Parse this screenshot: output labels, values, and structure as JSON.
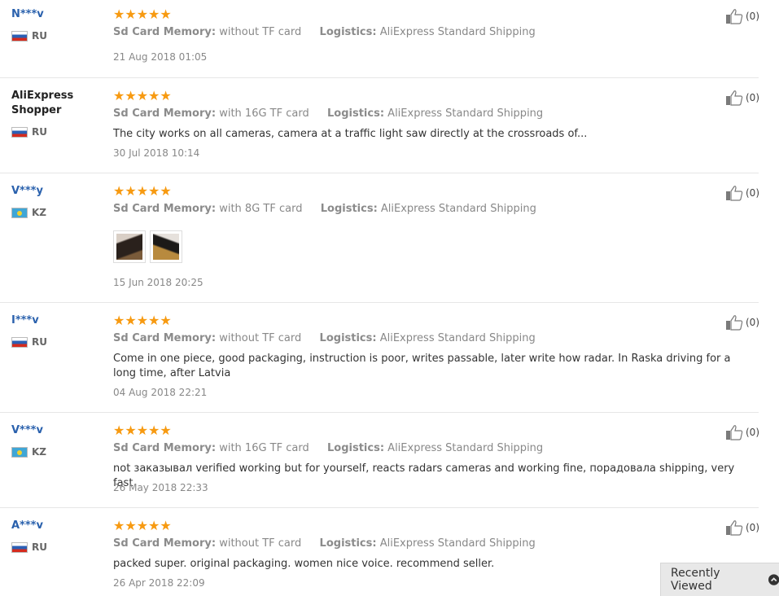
{
  "labels": {
    "sd_card_memory": "Sd Card Memory:",
    "logistics": "Logistics:"
  },
  "reviews": [
    {
      "user": "N***v",
      "country": "RU",
      "rating": "★★★★★",
      "sd_card": "without TF card",
      "logistics": "AliExpress Standard Shipping",
      "comment": "",
      "date": "21 Aug 2018 01:05",
      "helpful": "(0)"
    },
    {
      "user": "AliExpress Shopper",
      "country": "RU",
      "rating": "★★★★★",
      "sd_card": "with 16G TF card",
      "logistics": "AliExpress Standard Shipping",
      "comment": "The city works on all cameras, camera at a traffic light saw directly at the crossroads of...",
      "date": "30 Jul 2018 10:14",
      "helpful": "(0)"
    },
    {
      "user": "V***y",
      "country": "KZ",
      "rating": "★★★★★",
      "sd_card": "with 8G TF card",
      "logistics": "AliExpress Standard Shipping",
      "comment": "",
      "date": "15 Jun 2018 20:25",
      "helpful": "(0)",
      "photos": 2
    },
    {
      "user": "I***v",
      "country": "RU",
      "rating": "★★★★★",
      "sd_card": "without TF card",
      "logistics": "AliExpress Standard Shipping",
      "comment": "Come in one piece, good packaging, instruction is poor, writes passable, later write how radar. In Raska driving for a long time, after Latvia",
      "date": "04 Aug 2018 22:21",
      "helpful": "(0)"
    },
    {
      "user": "V***v",
      "country": "KZ",
      "rating": "★★★★★",
      "sd_card": "with 16G TF card",
      "logistics": "AliExpress Standard Shipping",
      "comment": "not заказывал verified working but for yourself, reacts radars cameras and working fine, порадовала shipping, very fast",
      "date": "26 May 2018 22:33",
      "helpful": "(0)"
    },
    {
      "user": "A***v",
      "country": "RU",
      "rating": "★★★★★",
      "sd_card": "without TF card",
      "logistics": "AliExpress Standard Shipping",
      "comment": "packed super. original packaging. women nice voice. recommend seller.",
      "date": "26 Apr 2018 22:09",
      "helpful": "(0)"
    }
  ],
  "recently_viewed": {
    "label": "Recently Viewed",
    "icon": "chevron-up-circle-icon"
  },
  "colors": {
    "star": "#f79a11",
    "username": "#2a61ad"
  }
}
